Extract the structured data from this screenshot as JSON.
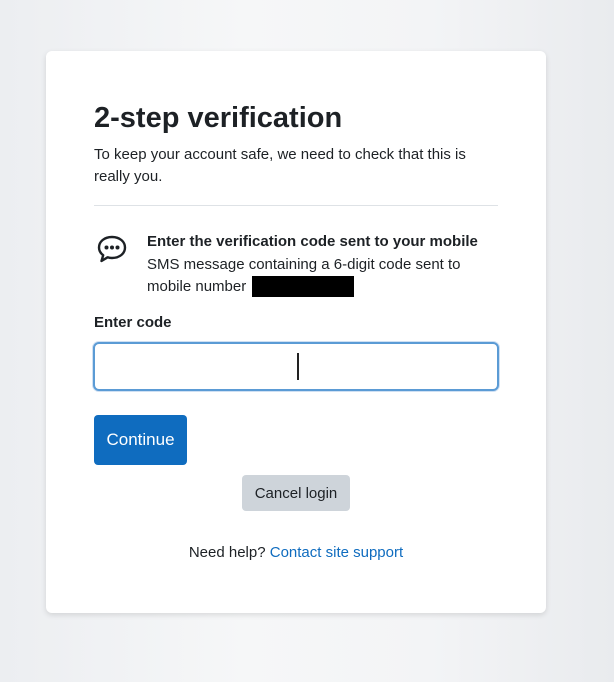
{
  "page": {
    "title": "2-step verification",
    "subtitle": "To keep your account safe, we need to check that this is really you."
  },
  "method": {
    "icon": "chat-bubble-icon",
    "heading": "Enter the verification code sent to your mobile",
    "description": "SMS message containing a 6-digit code sent to mobile number"
  },
  "form": {
    "code_label": "Enter code",
    "code_value": "",
    "continue_label": "Continue",
    "cancel_label": "Cancel login"
  },
  "help": {
    "prefix": "Need help?",
    "link_label": "Contact site support"
  },
  "colors": {
    "primary": "#0f6cbf",
    "secondary_button": "#ced4da",
    "input_focus": "#5b9bd5",
    "text": "#1d2125"
  }
}
